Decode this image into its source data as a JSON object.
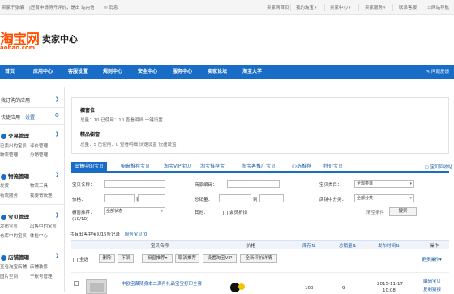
{
  "topbar": {
    "greeting": "卖家千张编",
    "notice": "|还有申请待开评价，是出  站内信",
    "message": "消息",
    "links": [
      {
        "label": "卖家网首页"
      },
      {
        "label": "我的淘宝"
      },
      {
        "label": "卖家中心"
      },
      {
        "label": "卖家服务"
      },
      {
        "label": "联系客服"
      },
      {
        "label": "网站导航"
      }
    ]
  },
  "header": {
    "logo_cn": "淘宝网",
    "logo_en": "aobao.com",
    "title": "卖家中心"
  },
  "nav": {
    "items": [
      "首页",
      "应用中心",
      "客服设置",
      "规则中心",
      "安全中心",
      "服务中心",
      "卖家论坛",
      "淘宝大学"
    ],
    "right": "问题反馈"
  },
  "sidebar": {
    "recent_apps": "我订购的应用",
    "quick_apps": "快捷应用",
    "quick_settings": "设置",
    "sections": [
      {
        "title": "交易管理",
        "subs": [
          "已卖出的宝贝",
          "评价管理",
          "物流管理",
          "分销管理"
        ]
      },
      {
        "title": "物流管理",
        "subs": [
          "发货",
          "物流工具",
          "物流服务",
          "我要寄快递"
        ]
      },
      {
        "title": "宝贝管理",
        "subs": [
          "发布宝贝",
          "出售中的宝贝",
          "仓库中的宝贝",
          "体检中心"
        ]
      },
      {
        "title": "店铺管理",
        "subs": [
          "查看淘宝店铺",
          "店铺装修",
          "图片空间",
          "子账号管理"
        ]
      }
    ]
  },
  "summary": {
    "block1_title": "橱窗位",
    "block1_line": "总量：10      已使用：10      查看明细    一键设置",
    "block2_title": "精品橱窗",
    "block2_line": "总量：5      已使用：0      查看明细    快速设置   快捷设置"
  },
  "tabs": {
    "items": [
      "出售中的宝贝",
      "橱窗推荐宝贝",
      "淘宝VIP宝贝",
      "淘宝推荐宝",
      "淘宝客推广宝贝",
      "心选推荐",
      "特价宝贝"
    ],
    "right": "宝贝回收站"
  },
  "filters": {
    "title_label": "宝贝名称：",
    "merchant_code_label": "商家编码：",
    "category_label": "宝贝类目：",
    "category_value": "全部类目",
    "price_label": "价格：",
    "to": "到",
    "sales_label": "总销量：",
    "shop_category_label": "店铺中分类：",
    "shop_category_value": "全部分类",
    "sale_status_label": "橱窗推荐：",
    "sale_status_value": "全部状态",
    "other_label": "其他：",
    "other_option": "会员折扣",
    "clear_label": "清空条件",
    "search_button": "搜索",
    "page_indicator": "(10/10)"
  },
  "count": {
    "text": "共有出售中宝贝15条记录",
    "link": "服务宝贝(0)"
  },
  "table": {
    "headers": [
      "宝贝名称",
      "价格",
      "库存",
      "总销量",
      "发布时间",
      "操作"
    ]
  },
  "actions": {
    "select_all": "全选",
    "delete": "删除",
    "delist": "下架",
    "window_recommend": "橱窗推荐",
    "cancel_recommend": "取消推荐",
    "set_vip": "设置淘宝VIP",
    "set_discount": "全新评价详情",
    "sort_label": "更多操作"
  },
  "rows": [
    {
      "title": "中欧宝藏随身本二满月礼品宝宝打印全套",
      "price": "",
      "stock": "100",
      "sales": "9",
      "date": "2015-11-17",
      "time": "10:08",
      "op1": "编辑宝贝",
      "op2": "复制链接"
    }
  ]
}
